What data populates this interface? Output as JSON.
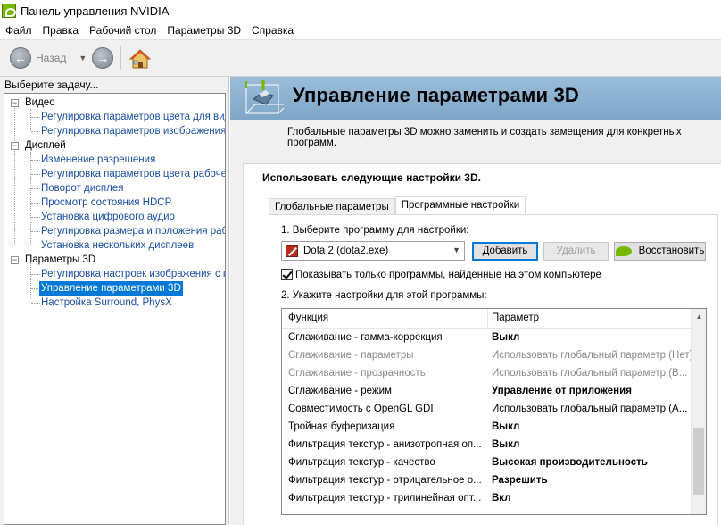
{
  "window": {
    "title": "Панель управления NVIDIA"
  },
  "menu": [
    {
      "label": "Файл"
    },
    {
      "label": "Правка"
    },
    {
      "label": "Рабочий стол"
    },
    {
      "label": "Параметры 3D"
    },
    {
      "label": "Справка"
    }
  ],
  "toolbar": {
    "back_label": "Назад"
  },
  "left": {
    "task_label": "Выберите задачу...",
    "categories": [
      {
        "label": "Видео",
        "items": [
          "Регулировка параметров цвета для вид",
          "Регулировка параметров изображения д"
        ]
      },
      {
        "label": "Дисплей",
        "items": [
          "Изменение разрешения",
          "Регулировка параметров цвета рабочег",
          "Поворот дисплея",
          "Просмотр состояния HDCP",
          "Установка цифрового аудио",
          "Регулировка размера и положения рабо",
          "Установка нескольких дисплеев"
        ]
      },
      {
        "label": "Параметры 3D",
        "items": [
          "Регулировка настроек изображения с пр",
          "Управление параметрами 3D",
          "Настройка Surround, PhysX"
        ]
      }
    ]
  },
  "main": {
    "title": "Управление параметрами 3D",
    "description": "Глобальные параметры 3D можно заменить и создать замещения для конкретных программ.",
    "section_title": "Использовать следующие настройки 3D.",
    "tabs": [
      {
        "label": "Глобальные параметры",
        "active": false
      },
      {
        "label": "Программные настройки",
        "active": true
      }
    ],
    "step1_label": "1. Выберите программу для настройки:",
    "program_selected": "Dota 2 (dota2.exe)",
    "btn_add": "Добавить",
    "btn_delete": "Удалить",
    "btn_restore": "Восстановить",
    "checkbox_label": "Показывать только программы, найденные на этом компьютере",
    "checkbox_checked": true,
    "step2_label": "2. Укажите настройки для этой программы:",
    "table": {
      "col_feature": "Функция",
      "col_setting": "Параметр",
      "rows": [
        {
          "feature": "Сглаживание - гамма-коррекция",
          "setting": "Выкл",
          "bold": true,
          "dim": false
        },
        {
          "feature": "Сглаживание - параметры",
          "setting": "Использовать глобальный параметр (Нет)",
          "bold": false,
          "dim": true
        },
        {
          "feature": "Сглаживание - прозрачность",
          "setting": "Использовать глобальный параметр (В...",
          "bold": false,
          "dim": true
        },
        {
          "feature": "Сглаживание - режим",
          "setting": "Управление от приложения",
          "bold": true,
          "dim": false
        },
        {
          "feature": "Совместимость с OpenGL GDI",
          "setting": "Использовать глобальный параметр (А...",
          "bold": false,
          "dim": false
        },
        {
          "feature": "Тройная буферизация",
          "setting": "Выкл",
          "bold": true,
          "dim": false
        },
        {
          "feature": "Фильтрация текстур - анизотропная оп...",
          "setting": "Выкл",
          "bold": true,
          "dim": false
        },
        {
          "feature": "Фильтрация текстур - качество",
          "setting": "Высокая производительность",
          "bold": true,
          "dim": false
        },
        {
          "feature": "Фильтрация текстур - отрицательное о...",
          "setting": "Разрешить",
          "bold": true,
          "dim": false
        },
        {
          "feature": "Фильтрация текстур - трилинейная опт...",
          "setting": "Вкл",
          "bold": true,
          "dim": false
        }
      ]
    }
  },
  "colors": {
    "accent": "#0078d7",
    "link": "#1a4fa3",
    "nvidia_green": "#76b900",
    "banner": "#8fb3d2"
  }
}
